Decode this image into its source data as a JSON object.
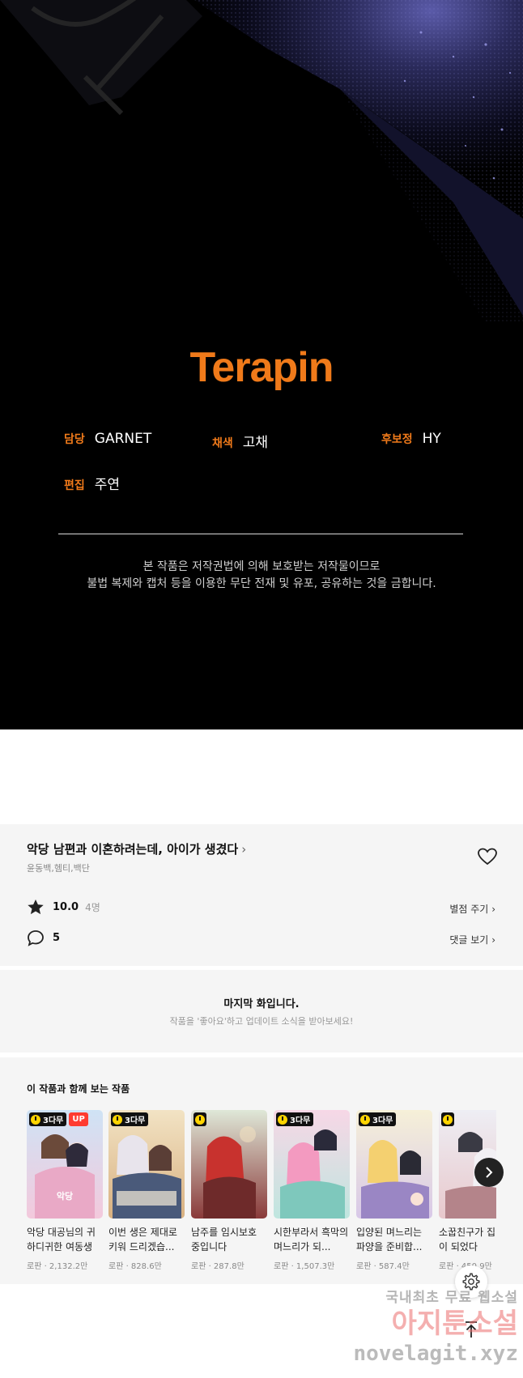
{
  "credits": {
    "logo": "Terapin",
    "staff": [
      {
        "role": "담당",
        "name": "GARNET"
      },
      {
        "role": "채색",
        "name": "고채"
      },
      {
        "role": "후보정",
        "name": "HY"
      },
      {
        "role": "편집",
        "name": "주연"
      }
    ],
    "notice_line1": "본 작품은 저작권법에 의해 보호받는 저작물이므로",
    "notice_line2": "불법 복제와 캡처 등을 이용한 무단 전재 및 유포, 공유하는 것을 금합니다."
  },
  "series": {
    "title": "악당 남편과 이혼하려는데, 아이가 생겼다",
    "genre": "윤동백,헴티,백단",
    "rating": "10.0",
    "rating_count": "4명",
    "rate_link": "별점 주기",
    "comment_count": "5",
    "comment_link": "댓글 보기"
  },
  "last_episode": {
    "title": "마지막 화입니다.",
    "subtitle": "작품을 '좋아요'하고 업데이트 소식을 받아보세요!"
  },
  "recommendations": {
    "heading": "이 작품과 함께 보는 작품",
    "items": [
      {
        "title": "악당 대공님의 귀하디귀한 여동생",
        "meta": "로판 · 2,132.2만",
        "badge": "3다무",
        "up": "UP"
      },
      {
        "title": "이번 생은 제대로 키워 드리겠습...",
        "meta": "로판 · 828.6만",
        "badge": "3다무",
        "up": ""
      },
      {
        "title": "남주를 임시보호 중입니다",
        "meta": "로판 · 287.8만",
        "badge": "",
        "up": ""
      },
      {
        "title": "시한부라서 흑막의 며느리가 되...",
        "meta": "로판 · 1,507.3만",
        "badge": "3다무",
        "up": ""
      },
      {
        "title": "입양된 며느리는 파양을 준비합...",
        "meta": "로판 · 587.4만",
        "badge": "3다무",
        "up": ""
      },
      {
        "title": "소꿉친구가 집남편이 되었다",
        "meta": "로판 · 450.9만",
        "badge": "",
        "up": ""
      }
    ]
  },
  "watermark": {
    "line1": "국내최초 무료 웹소설",
    "line2": "아지툰소설",
    "line3": "novelagit.xyz"
  }
}
